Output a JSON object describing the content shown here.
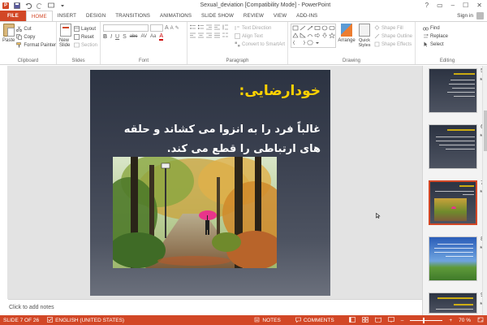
{
  "window": {
    "title": "Sexual_deviation [Compatibility Mode] - PowerPoint",
    "controls": [
      "?",
      "▭",
      "–",
      "☐",
      "✕"
    ]
  },
  "tabs": [
    "FILE",
    "HOME",
    "INSERT",
    "DESIGN",
    "TRANSITIONS",
    "ANIMATIONS",
    "SLIDE SHOW",
    "REVIEW",
    "VIEW",
    "ADD-INS"
  ],
  "active_tab": "HOME",
  "sign_in": "Sign in",
  "ribbon": {
    "clipboard": {
      "paste": "Paste",
      "cut": "Cut",
      "copy": "Copy",
      "format_painter": "Format Painter",
      "label": "Clipboard"
    },
    "slides": {
      "new_slide": "New Slide",
      "layout": "Layout",
      "reset": "Reset",
      "section": "Section",
      "label": "Slides"
    },
    "font": {
      "label": "Font",
      "format_buttons": [
        "B",
        "I",
        "U",
        "S",
        "abc",
        "AV",
        "Aa",
        "A"
      ]
    },
    "paragraph": {
      "text_direction": "Text Direction",
      "align_text": "Align Text",
      "convert_smartart": "Convert to SmartArt",
      "label": "Paragraph"
    },
    "drawing": {
      "arrange": "Arrange",
      "quick_styles": "Quick Styles",
      "shape_fill": "Shape Fill",
      "shape_outline": "Shape Outline",
      "shape_effects": "Shape Effects",
      "label": "Drawing"
    },
    "editing": {
      "find": "Find",
      "replace": "Replace",
      "select": "Select",
      "label": "Editing"
    }
  },
  "slide": {
    "title": "خودارضایی:",
    "body": "غالباً فرد را به انزوا می کشاند و حلقه های ارتباطی را قطع می کند."
  },
  "notes_placeholder": "Click to add notes",
  "thumbnails": [
    {
      "number": "5",
      "star": "★"
    },
    {
      "number": "6",
      "star": "★"
    },
    {
      "number": "7",
      "star": "★",
      "selected": true
    },
    {
      "number": "8",
      "star": "★"
    },
    {
      "number": "9",
      "star": "★"
    }
  ],
  "status": {
    "slide": "SLIDE 7 OF 26",
    "language": "ENGLISH (UNITED STATES)",
    "notes": "NOTES",
    "comments": "COMMENTS",
    "zoom": "70 %",
    "zoom_minus": "–",
    "zoom_plus": "+"
  },
  "colors": {
    "accent": "#d24726",
    "slide_title": "#ffd200",
    "slide_bg": "#3b4150"
  }
}
